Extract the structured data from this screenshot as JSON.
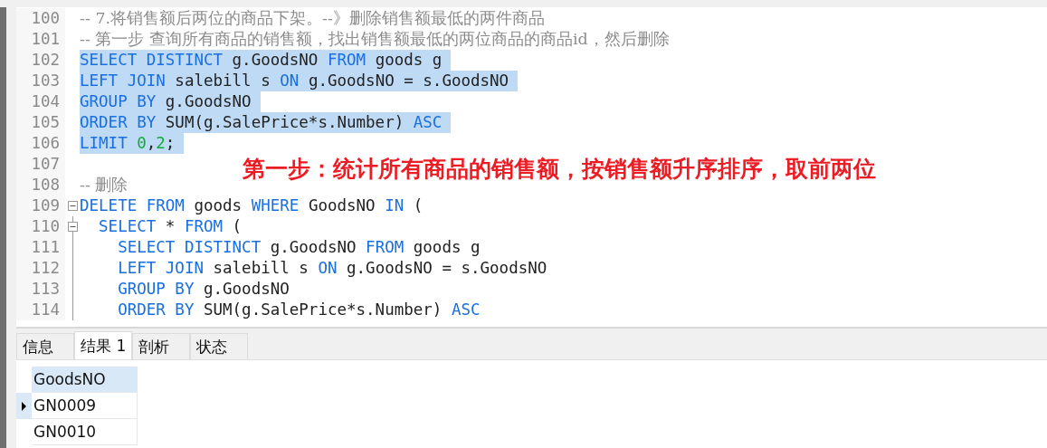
{
  "editor": {
    "lines": [
      {
        "number": "100",
        "selected": false,
        "tokens": [
          {
            "kind": "comment",
            "text": "-- 7.将销售额后两位的商品下架。--》删除销售额最低的两件商品"
          }
        ]
      },
      {
        "number": "101",
        "selected": false,
        "tokens": [
          {
            "kind": "comment",
            "text": "-- 第一步 查询所有商品的销售额，找出销售额最低的两位商品的商品id，然后删除"
          }
        ]
      },
      {
        "number": "102",
        "selected": true,
        "tokens": [
          {
            "kind": "keyword",
            "text": "SELECT DISTINCT"
          },
          {
            "kind": "plain",
            "text": " g.GoodsNO "
          },
          {
            "kind": "keyword",
            "text": "FROM"
          },
          {
            "kind": "plain",
            "text": " goods g"
          }
        ]
      },
      {
        "number": "103",
        "selected": true,
        "tokens": [
          {
            "kind": "keyword",
            "text": "LEFT JOIN"
          },
          {
            "kind": "plain",
            "text": " salebill s "
          },
          {
            "kind": "keyword",
            "text": "ON"
          },
          {
            "kind": "plain",
            "text": " g.GoodsNO = s.GoodsNO"
          }
        ]
      },
      {
        "number": "104",
        "selected": true,
        "tokens": [
          {
            "kind": "keyword",
            "text": "GROUP BY"
          },
          {
            "kind": "plain",
            "text": " g.GoodsNO"
          }
        ]
      },
      {
        "number": "105",
        "selected": true,
        "tokens": [
          {
            "kind": "keyword",
            "text": "ORDER BY"
          },
          {
            "kind": "plain",
            "text": " SUM(g.SalePrice*s.Number) "
          },
          {
            "kind": "keyword",
            "text": "ASC"
          }
        ]
      },
      {
        "number": "106",
        "selected": true,
        "tokens": [
          {
            "kind": "keyword",
            "text": "LIMIT "
          },
          {
            "kind": "number",
            "text": "0"
          },
          {
            "kind": "plain",
            "text": ","
          },
          {
            "kind": "number",
            "text": "2"
          },
          {
            "kind": "plain",
            "text": ";"
          }
        ]
      },
      {
        "number": "107"
      },
      {
        "number": "108",
        "selected": false,
        "tokens": [
          {
            "kind": "comment",
            "text": "-- 删除"
          }
        ]
      },
      {
        "number": "109",
        "selected": false,
        "expanded": true,
        "tokens": [
          {
            "kind": "keyword",
            "text": "DELETE FROM"
          },
          {
            "kind": "plain",
            "text": " goods "
          },
          {
            "kind": "keyword",
            "text": "WHERE"
          },
          {
            "kind": "plain",
            "text": " GoodsNO "
          },
          {
            "kind": "keyword",
            "text": "IN"
          },
          {
            "kind": "plain",
            "text": " ("
          }
        ]
      },
      {
        "number": "110",
        "selected": false,
        "expanded": true,
        "tokens": [
          {
            "kind": "keyword",
            "text": "  SELECT"
          },
          {
            "kind": "plain",
            "text": " * "
          },
          {
            "kind": "keyword",
            "text": "FROM"
          },
          {
            "kind": "plain",
            "text": " ("
          }
        ]
      },
      {
        "number": "111",
        "selected": false,
        "tokens": [
          {
            "kind": "keyword",
            "text": "    SELECT DISTINCT"
          },
          {
            "kind": "plain",
            "text": " g.GoodsNO "
          },
          {
            "kind": "keyword",
            "text": "FROM"
          },
          {
            "kind": "plain",
            "text": " goods g"
          }
        ]
      },
      {
        "number": "112",
        "selected": false,
        "tokens": [
          {
            "kind": "keyword",
            "text": "    LEFT JOIN"
          },
          {
            "kind": "plain",
            "text": " salebill s "
          },
          {
            "kind": "keyword",
            "text": "ON"
          },
          {
            "kind": "plain",
            "text": " g.GoodsNO = s.GoodsNO"
          }
        ]
      },
      {
        "number": "113",
        "selected": false,
        "tokens": [
          {
            "kind": "keyword",
            "text": "    GROUP BY"
          },
          {
            "kind": "plain",
            "text": " g.GoodsNO"
          }
        ]
      },
      {
        "number": "114",
        "selected": false,
        "tokens": [
          {
            "kind": "keyword",
            "text": "    ORDER BY"
          },
          {
            "kind": "plain",
            "text": " SUM(g.SalePrice*s.Number) "
          },
          {
            "kind": "keyword",
            "text": "ASC"
          }
        ]
      }
    ],
    "annotation": "第一步：统计所有商品的销售额，按销售额升序排序，取前两位"
  },
  "tabs": [
    {
      "label": "信息",
      "selected": false
    },
    {
      "label": "结果 1",
      "selected": true
    },
    {
      "label": "剖析",
      "selected": false
    },
    {
      "label": "状态",
      "selected": false
    }
  ],
  "result": {
    "columns": [
      "GoodsNO"
    ],
    "rows": [
      {
        "current": true,
        "cells": [
          "GN0009"
        ]
      },
      {
        "current": false,
        "cells": [
          "GN0010"
        ]
      }
    ]
  }
}
